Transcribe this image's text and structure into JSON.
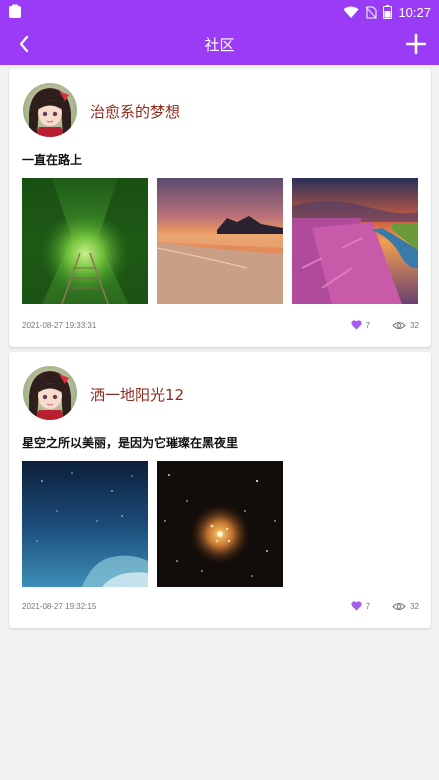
{
  "status_bar": {
    "time": "10:27"
  },
  "app_bar": {
    "title": "社区",
    "back_icon": "chevron-left-icon",
    "add_icon": "plus-icon"
  },
  "colors": {
    "primary": "#9a3cf5",
    "username": "#8e2a1c",
    "like": "#a35bf0"
  },
  "posts": [
    {
      "username": "治愈系的梦想",
      "content": "一直在路上",
      "images": [
        "green-tunnel-photo",
        "sunset-beach-photo",
        "flower-coast-photo"
      ],
      "time": "2021-08-27 19:33:31",
      "likes": "7",
      "views": "32"
    },
    {
      "username": "洒一地阳光12",
      "content": "星空之所以美丽，是因为它璀璨在黑夜里",
      "images": [
        "night-sky-photo",
        "star-cluster-photo"
      ],
      "time": "2021-08-27 19:32:15",
      "likes": "7",
      "views": "32"
    }
  ]
}
